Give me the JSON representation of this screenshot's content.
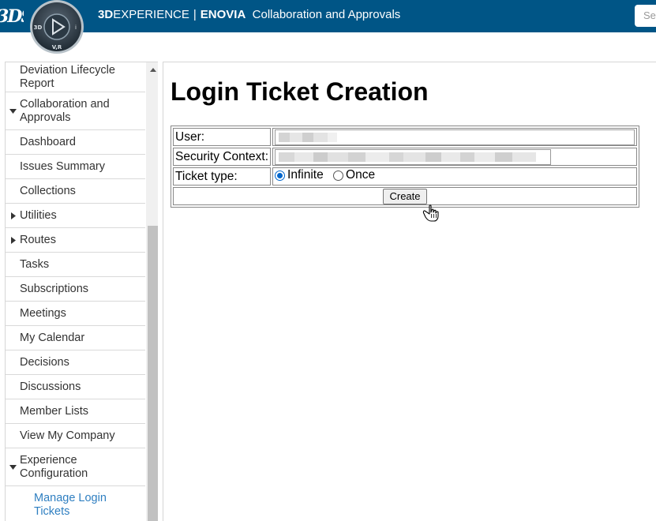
{
  "topbar": {
    "logo": "3DS",
    "compass_labels": {
      "top": "",
      "left": "3D",
      "right": "i",
      "bottom": "V,R"
    },
    "brand_prefix": "3D",
    "brand_suffix": "EXPERIENCE",
    "separator": "|",
    "product": "ENOVIA",
    "app_name": "Collaboration and Approvals",
    "search_placeholder": "Se",
    "accent": "#005586"
  },
  "sidebar": {
    "items": [
      {
        "label": "Deviation Lifecycle Report",
        "caret": "none"
      },
      {
        "label": "Collaboration and Approvals",
        "caret": "down"
      },
      {
        "label": "Dashboard",
        "caret": "none"
      },
      {
        "label": "Issues Summary",
        "caret": "none"
      },
      {
        "label": "Collections",
        "caret": "none"
      },
      {
        "label": "Utilities",
        "caret": "right"
      },
      {
        "label": "Routes",
        "caret": "right"
      },
      {
        "label": "Tasks",
        "caret": "none"
      },
      {
        "label": "Subscriptions",
        "caret": "none"
      },
      {
        "label": "Meetings",
        "caret": "none"
      },
      {
        "label": "My Calendar",
        "caret": "none"
      },
      {
        "label": "Decisions",
        "caret": "none"
      },
      {
        "label": "Discussions",
        "caret": "none"
      },
      {
        "label": "Member Lists",
        "caret": "none"
      },
      {
        "label": "View My Company",
        "caret": "none"
      },
      {
        "label": "Experience Configuration",
        "caret": "down"
      },
      {
        "label": "Manage Login Tickets",
        "caret": "none",
        "sub": true
      }
    ],
    "link_color": "#2f7fc1"
  },
  "main": {
    "title": "Login Ticket Creation",
    "form": {
      "user_label": "User:",
      "security_context_label": "Security Context:",
      "ticket_type_label": "Ticket type:",
      "ticket_options": [
        "Infinite",
        "Once"
      ],
      "ticket_selected": "Infinite",
      "create_label": "Create"
    }
  }
}
